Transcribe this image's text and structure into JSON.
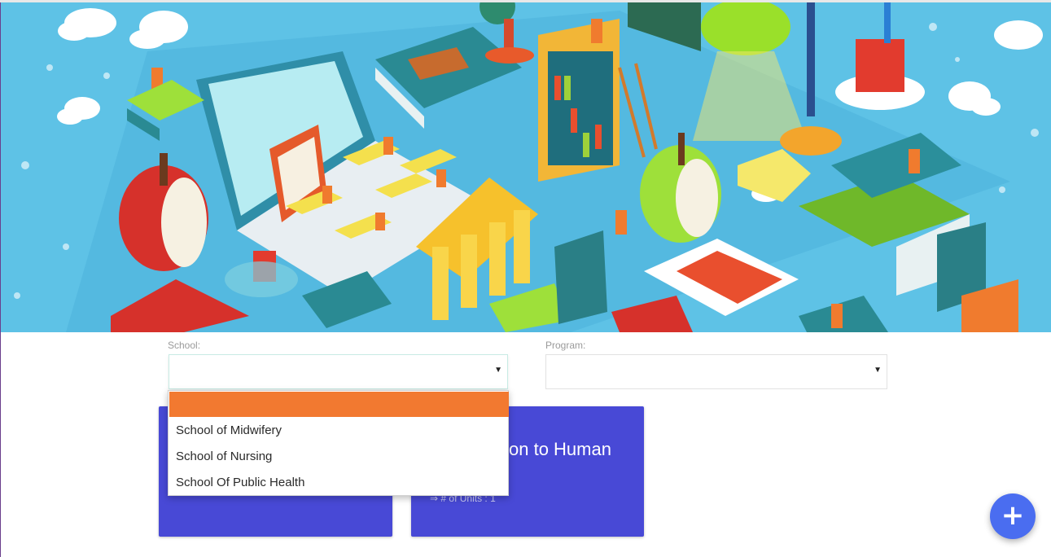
{
  "banner": {
    "icon": "education-illustration"
  },
  "form": {
    "school": {
      "label": "School:",
      "value": "",
      "arrow": "▼"
    },
    "program": {
      "label": "Program:",
      "value": "",
      "arrow": "▼"
    }
  },
  "school_dropdown": {
    "selected_index": 0,
    "options": [
      "",
      "School of Midwifery",
      "School of Nursing",
      "School Of Public Health"
    ]
  },
  "cards": [
    {
      "title": "",
      "units_label": ""
    },
    {
      "title": "on to Human",
      "units_label": "⇒ # of Units : 1"
    }
  ],
  "fab": {
    "label": "+",
    "icon": "plus-icon"
  },
  "colors": {
    "card": "#4849d6",
    "dropdown_highlight": "#f27930",
    "fab": "#4a6df0"
  }
}
